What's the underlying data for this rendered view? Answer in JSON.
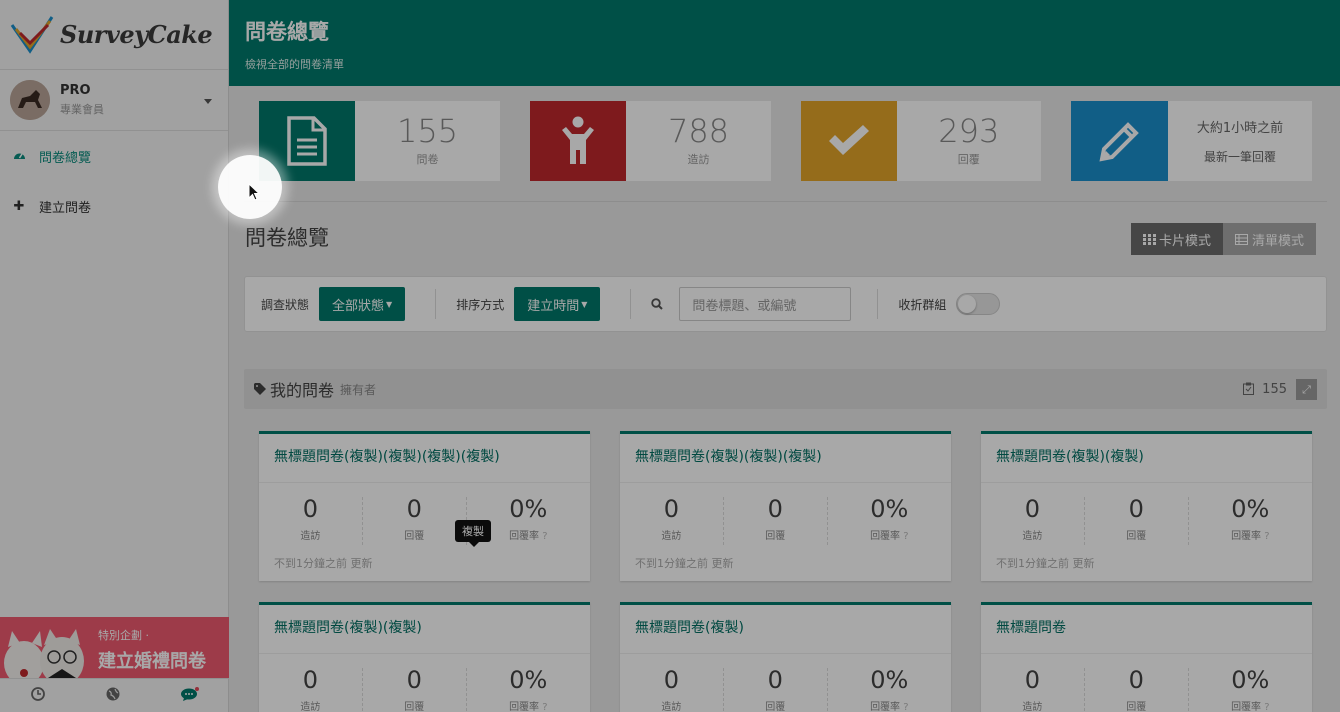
{
  "sidebar": {
    "logo": {
      "text": "SurveyCake"
    },
    "user": {
      "plan": "PRO",
      "role": "專業會員"
    },
    "nav": [
      {
        "label": "問卷總覽",
        "icon": "dashboard-icon",
        "active": true
      },
      {
        "label": "建立問卷",
        "icon": "plus-icon",
        "active": false
      }
    ],
    "promo": {
      "subtitle": "特別企劃 ·",
      "title": "建立婚禮問卷"
    },
    "bottom_icons": [
      "history-icon",
      "globe-icon",
      "chat-icon"
    ]
  },
  "header": {
    "title": "問卷總覽",
    "subtitle": "檢視全部的問卷清單"
  },
  "stats": [
    {
      "value": "155",
      "label": "問卷",
      "color": "#00796b",
      "icon": "document-icon"
    },
    {
      "value": "788",
      "label": "造訪",
      "color": "#c0282d",
      "icon": "person-icon"
    },
    {
      "value": "293",
      "label": "回覆",
      "color": "#e3a42a",
      "icon": "check-icon"
    },
    {
      "value": "大約1小時之前",
      "label": "最新一筆回覆",
      "color": "#1a8fcc",
      "icon": "pencil-icon"
    }
  ],
  "main": {
    "title": "問卷總覽",
    "view_modes": [
      {
        "label": "卡片模式",
        "active": true
      },
      {
        "label": "清單模式",
        "active": false
      }
    ]
  },
  "filter": {
    "status_label": "調查狀態",
    "status_value": "全部狀態",
    "sort_label": "排序方式",
    "sort_value": "建立時間",
    "search_placeholder": "問卷標題、或編號",
    "collapse_label": "收折群組"
  },
  "group": {
    "title": "我的問卷",
    "owner": "擁有者",
    "count": "155"
  },
  "tooltip": "複製",
  "cards": [
    {
      "title": "無標題問卷(複製)(複製)(複製)(複製)",
      "visits": "0",
      "visits_label": "造訪",
      "replies": "0",
      "replies_label": "回覆",
      "rate": "0%",
      "rate_label": "回覆率",
      "updated": "不到1分鐘之前 更新"
    },
    {
      "title": "無標題問卷(複製)(複製)(複製)",
      "visits": "0",
      "visits_label": "造訪",
      "replies": "0",
      "replies_label": "回覆",
      "rate": "0%",
      "rate_label": "回覆率",
      "updated": "不到1分鐘之前 更新"
    },
    {
      "title": "無標題問卷(複製)(複製)",
      "visits": "0",
      "visits_label": "造訪",
      "replies": "0",
      "replies_label": "回覆",
      "rate": "0%",
      "rate_label": "回覆率",
      "updated": "不到1分鐘之前 更新"
    },
    {
      "title": "無標題問卷(複製)(複製)",
      "visits": "0",
      "visits_label": "造訪",
      "replies": "0",
      "replies_label": "回覆",
      "rate": "0%",
      "rate_label": "回覆率",
      "updated": ""
    },
    {
      "title": "無標題問卷(複製)",
      "visits": "0",
      "visits_label": "造訪",
      "replies": "0",
      "replies_label": "回覆",
      "rate": "0%",
      "rate_label": "回覆率",
      "updated": ""
    },
    {
      "title": "無標題問卷",
      "visits": "0",
      "visits_label": "造訪",
      "replies": "0",
      "replies_label": "回覆",
      "rate": "0%",
      "rate_label": "回覆率",
      "updated": ""
    }
  ]
}
